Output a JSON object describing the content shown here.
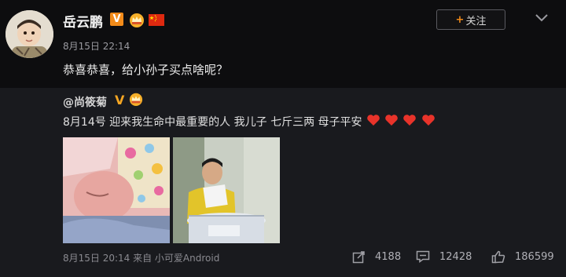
{
  "poster": {
    "name": "岳云鹏",
    "verified_mark": "V",
    "time": "8月15日 22:14",
    "text": "恭喜恭喜，给小孙子买点啥呢？"
  },
  "follow_button": {
    "plus": "+",
    "label": "关注"
  },
  "original": {
    "author": "@尚筱菊",
    "verified_mark": "V",
    "text": "8月14号 迎来我生命中最重要的人 我儿子 七斤三两 母子平安",
    "heart_count": 4,
    "footer_time": "8月15日 20:14 来自 小可爱Android"
  },
  "actions": {
    "reposts": "4188",
    "comments": "12428",
    "likes": "186599"
  },
  "colors": {
    "background": "#0d0d0f",
    "repost_background": "#191a1e",
    "verified_orange": "#f28b1a",
    "heart_red": "#e8332a"
  },
  "icons": [
    "crown-icon",
    "china-flag-icon",
    "chevron-down-icon",
    "heart-icon",
    "repost-icon",
    "comment-icon",
    "like-icon"
  ]
}
